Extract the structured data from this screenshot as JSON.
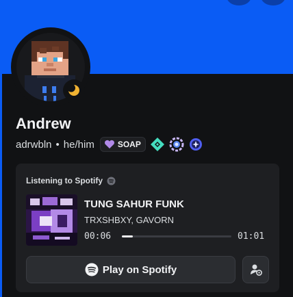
{
  "profile": {
    "display_name": "Andrew",
    "username": "adrwbln",
    "separator": "•",
    "pronouns": "he/him",
    "clan_tag": "SOAP",
    "status": "idle-moon-icon",
    "badges": [
      "hypesquad-balance-icon",
      "server-booster-icon",
      "quest-badge-icon"
    ]
  },
  "activity": {
    "header": "Listening to Spotify",
    "track_title": "TUNG SAHUR FUNK",
    "track_artist": "TRXSHBXY, GAVORN",
    "elapsed": "00:06",
    "duration": "01:01",
    "progress": 0.1,
    "play_label": "Play on Spotify"
  },
  "colors": {
    "banner": "#0a5cf5",
    "background": "#111214",
    "card": "#1e1f22",
    "idle": "#f0b232",
    "hypesquad": "#45ddc0",
    "clan": "#b18ae8"
  }
}
